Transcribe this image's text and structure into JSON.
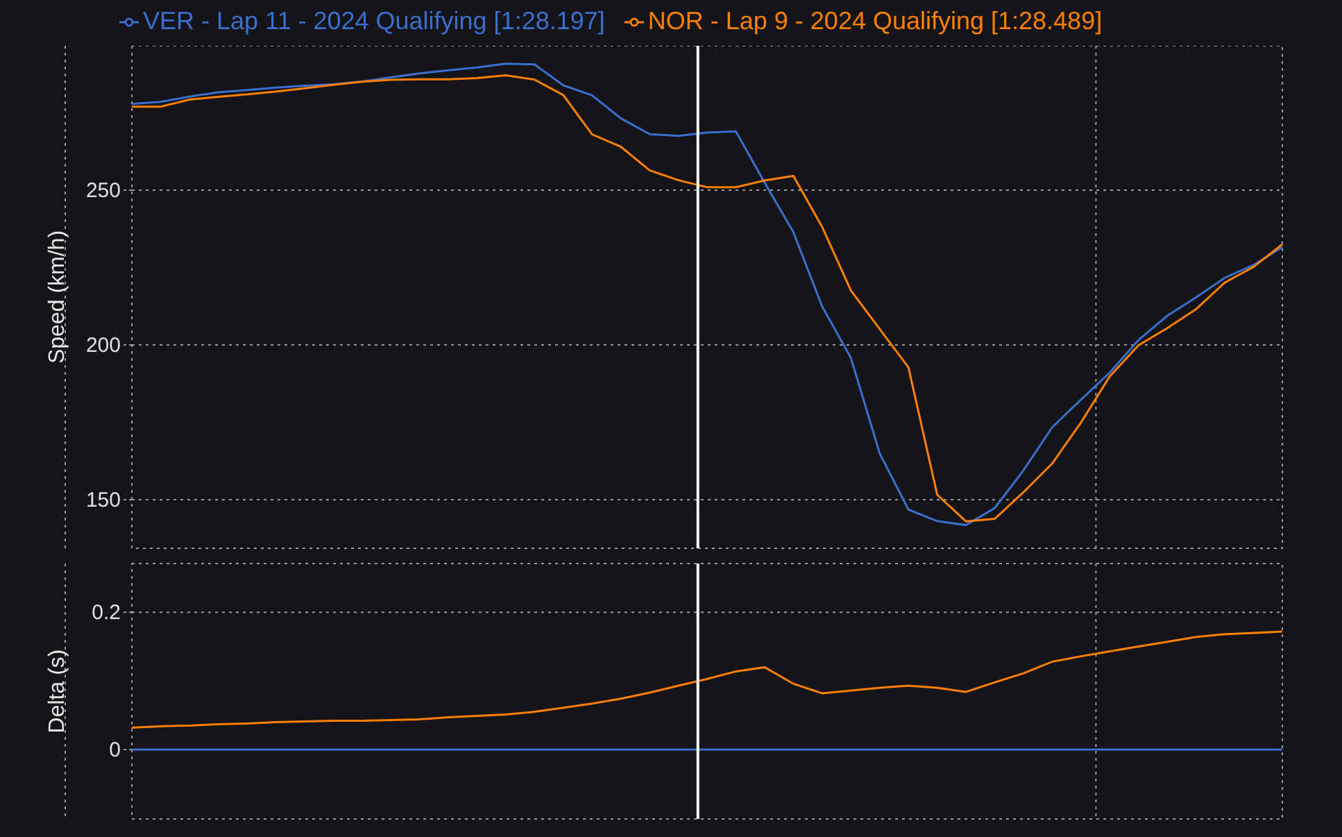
{
  "legend": [
    {
      "label": "VER - Lap 11 - 2024 Qualifying [1:28.197]",
      "color": "#3a6fd0"
    },
    {
      "label": "NOR - Lap 9 - 2024 Qualifying [1:28.489]",
      "color": "#ff8000"
    }
  ],
  "charts": [
    {
      "chart_data": {
        "type": "line",
        "grid": true,
        "ylabel": "Speed (km/h)",
        "ylim": [
          134.3,
          296.6
        ],
        "yticks": [
          150,
          200,
          250
        ],
        "categories": [
          null,
          null,
          null,
          null,
          null,
          null,
          null,
          null,
          null,
          null,
          null,
          null,
          null,
          null,
          null,
          null,
          null,
          null,
          null,
          null,
          null,
          null,
          null,
          null,
          null,
          null,
          null,
          null,
          null,
          null,
          null,
          null,
          null,
          null,
          null,
          null,
          null,
          null,
          null,
          null,
          null
        ],
        "series": [
          {
            "color": "#3a6fd0",
            "values": [
              277.8,
              278.5,
              280.2,
              281.6,
              282.3,
              283.1,
              283.7,
              284.2,
              285.1,
              286.4,
              287.7,
              288.7,
              289.6,
              290.8,
              290.6,
              283.8,
              280.6,
              273.2,
              268.1,
              267.5,
              268.6,
              269.0,
              252.4,
              236.4,
              212.4,
              195.8,
              164.9,
              146.8,
              143.1,
              141.8,
              147.3,
              159.5,
              173.4,
              182.3,
              191.0,
              201.6,
              209.4,
              215.3,
              221.7,
              225.8,
              231.6
            ]
          },
          {
            "color": "#ff8000",
            "values": [
              276.9,
              276.9,
              279.2,
              280.1,
              280.9,
              281.8,
              282.9,
              284.0,
              285.0,
              285.6,
              285.8,
              285.8,
              286.2,
              287.1,
              285.7,
              280.7,
              268.0,
              264.0,
              256.4,
              253.2,
              250.9,
              250.9,
              253.1,
              254.6,
              238.1,
              217.6,
              205.1,
              192.7,
              151.6,
              143,
              143.8,
              152.4,
              161.7,
              174.9,
              189.8,
              199.9,
              205.4,
              211.5,
              220.1,
              225.2,
              232.5
            ]
          }
        ]
      }
    },
    {
      "chart_data": {
        "type": "line",
        "grid": true,
        "ylabel": "Delta (s)",
        "ylim": [
          -0.101,
          0.271
        ],
        "yticks": [
          {
            "value": 0,
            "label": "0"
          },
          {
            "value": 0.2,
            "label": "0.2"
          }
        ],
        "categories": [
          null,
          null,
          null,
          null,
          null,
          null,
          null,
          null,
          null,
          null,
          null,
          null,
          null,
          null,
          null,
          null,
          null,
          null,
          null,
          null,
          null,
          null,
          null,
          null,
          null,
          null,
          null,
          null,
          null,
          null,
          null,
          null,
          null,
          null,
          null,
          null,
          null,
          null,
          null,
          null,
          null
        ],
        "series": [
          {
            "color": "#3a6fd0",
            "values": [
              0,
              0,
              0,
              0,
              0,
              0,
              0,
              0,
              0,
              0,
              0,
              0,
              0,
              0,
              0,
              0,
              0,
              0,
              0,
              0,
              0,
              0,
              0,
              0,
              0,
              0,
              0,
              0,
              0,
              0,
              0,
              0,
              0,
              0,
              0,
              0,
              0,
              0,
              0,
              0,
              0
            ]
          },
          {
            "color": "#ff8000",
            "values": [
              0.032,
              0.034,
              0.035,
              0.037,
              0.038,
              0.04,
              0.041,
              0.042,
              0.042,
              0.043,
              0.044,
              0.047,
              0.049,
              0.051,
              0.055,
              0.061,
              0.067,
              0.074,
              0.083,
              0.093,
              0.103,
              0.114,
              0.12,
              0.096,
              0.082,
              0.086,
              0.09,
              0.093,
              0.09,
              0.084,
              0.098,
              0.111,
              0.128,
              0.136,
              0.143,
              0.15,
              0.157,
              0.164,
              0.168,
              0.17,
              0.172
            ]
          }
        ]
      }
    }
  ]
}
